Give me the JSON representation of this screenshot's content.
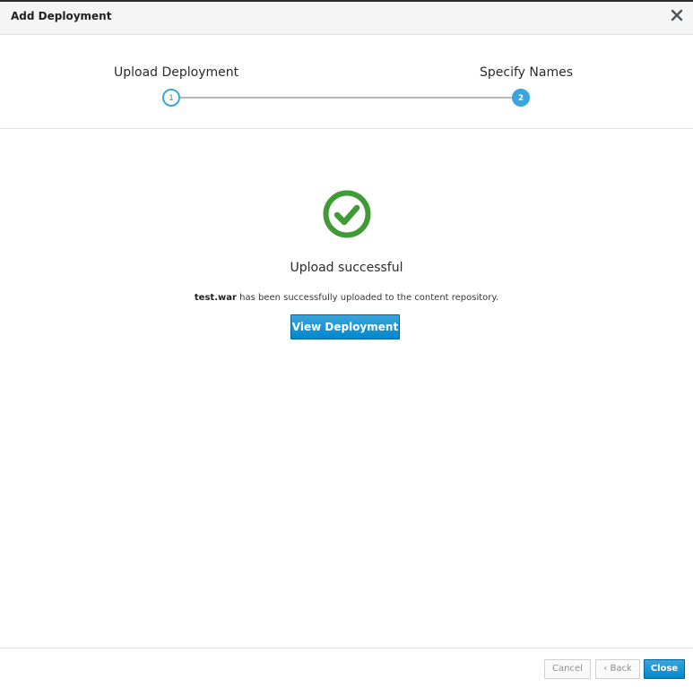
{
  "dialog": {
    "title": "Add Deployment",
    "close_icon": "close-icon"
  },
  "wizard": {
    "steps": [
      {
        "number": "1",
        "label": "Upload Deployment",
        "state": "completed"
      },
      {
        "number": "2",
        "label": "Specify Names",
        "state": "current"
      }
    ]
  },
  "result": {
    "icon": "check-circle-icon",
    "title": "Upload successful",
    "filename": "test.war",
    "message": " has been successfully uploaded to the content repository.",
    "view_button": "View Deployment"
  },
  "footer": {
    "cancel_label": "Cancel",
    "back_label": "Back",
    "back_icon": "chevron-left-icon",
    "close_label": "Close"
  },
  "colors": {
    "accent": "#0088ce",
    "step_active": "#39a5dc",
    "success": "#3f9c35"
  }
}
